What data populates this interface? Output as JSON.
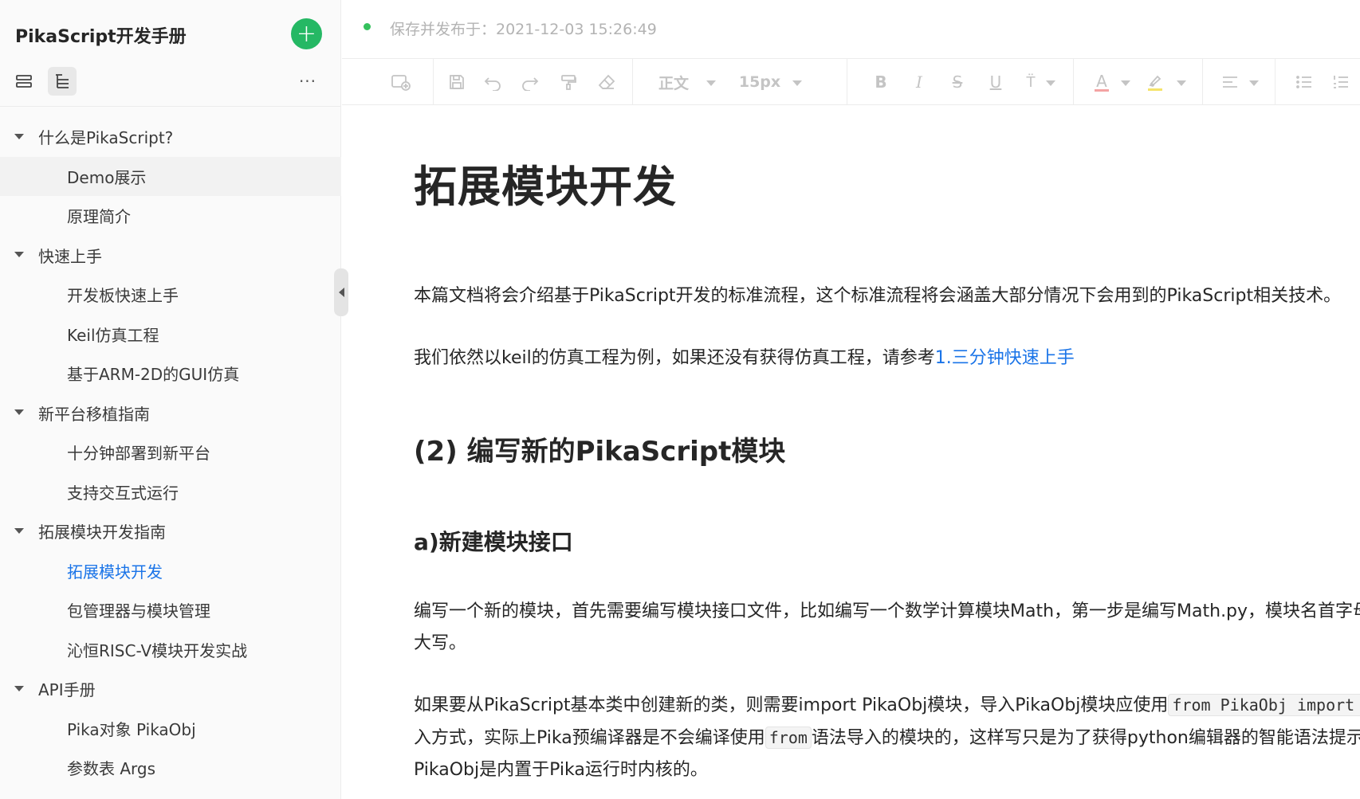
{
  "sidebar": {
    "book_title": "PikaScript开发手册",
    "add_icon": "plus-icon",
    "more_label": "···",
    "toc": [
      {
        "label": "什么是PikaScript?",
        "level": "group"
      },
      {
        "label": "Demo展示",
        "level": "child"
      },
      {
        "label": "原理简介",
        "level": "child"
      },
      {
        "label": "快速上手",
        "level": "group"
      },
      {
        "label": "开发板快速上手",
        "level": "child"
      },
      {
        "label": "Keil仿真工程",
        "level": "child"
      },
      {
        "label": "基于ARM-2D的GUI仿真",
        "level": "child"
      },
      {
        "label": "新平台移植指南",
        "level": "group"
      },
      {
        "label": "十分钟部署到新平台",
        "level": "child"
      },
      {
        "label": "支持交互式运行",
        "level": "child"
      },
      {
        "label": "拓展模块开发指南",
        "level": "group"
      },
      {
        "label": "拓展模块开发",
        "level": "child",
        "active": true
      },
      {
        "label": "包管理器与模块管理",
        "level": "child"
      },
      {
        "label": "沁恒RISC-V模块开发实战",
        "level": "child"
      },
      {
        "label": "API手册",
        "level": "group"
      },
      {
        "label": "Pika对象 PikaObj",
        "level": "child"
      },
      {
        "label": "参数表 Args",
        "level": "child"
      }
    ]
  },
  "status": {
    "text": "保存并发布于：2021-12-03 15:26:49",
    "dot_color": "#35c15d"
  },
  "toolbar": {
    "paragraph_style": "正文",
    "font_size": "15px"
  },
  "doc": {
    "title": "拓展模块开发",
    "p1": "本篇文档将会介绍基于PikaScript开发的标准流程，这个标准流程将会涵盖大部分情况下会用到的PikaScript相关技术。",
    "p2_prefix": "我们依然以keil的仿真工程为例，如果还没有获得仿真工程，请参考",
    "p2_link": "1.三分钟快速上手",
    "h2": "(2) 编写新的PikaScript模块",
    "h3": "a)新建模块接口",
    "p3_line1": "编写一个新的模块，首先需要编写模块接口文件，比如编写一个数学计算模块Math，第一步是编写Math.py，模块名首字母需要",
    "p3_line2": "大写。",
    "p4_line1_prefix": "如果要从PikaScript基本类中创建新的类，则需要import PikaObj模块，导入PikaObj模块应使用",
    "p4_code1": "from PikaObj import *",
    "p4_line2_prefix": "入方式，实际上Pika预编译器是不会编译使用",
    "p4_code2": "from",
    "p4_line2_suffix": "语法导入的模块的，这样写只是为了获得python编辑器的智能语法提示，",
    "p4_line3": "PikaObj是内置于Pika运行时内核的。"
  }
}
